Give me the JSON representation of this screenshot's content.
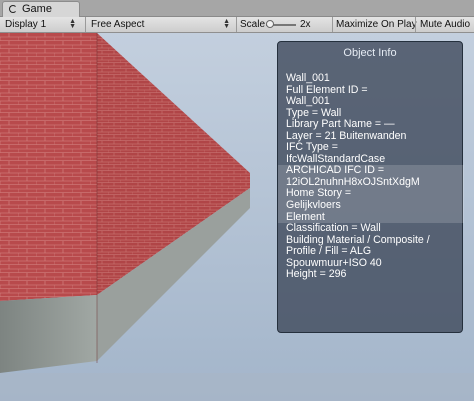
{
  "window": {
    "tab_label": "Game",
    "tab_icon": "unity-game-icon"
  },
  "toolbar": {
    "display": "Display 1",
    "aspect": "Free Aspect",
    "scale_label": "Scale",
    "scale_value": "2x",
    "scale_level": 0.1,
    "maximize": "Maximize On Play",
    "mute": "Mute Audio"
  },
  "info_panel": {
    "title": "Object Info",
    "lines": [
      "Wall_001",
      "Full Element ID          =",
      "Wall_001",
      "Type          = Wall",
      "Library Part Name        = —",
      "Layer         = 21 Buitenwanden",
      "IFC Type     =",
      "IfcWallStandardCase",
      "ARCHICAD IFC ID     =",
      "12iOL2nuhnH8xOJSntXdgM",
      "Home Story              =",
      "Gelijkvloers",
      "Element",
      "Classification              = Wall",
      "Building Material / Composite /",
      "Profile / Fill              = ALG",
      "Spouwmuur+ISO 40",
      "Height        = 296"
    ]
  },
  "scene": {
    "brick_color": "#b84a4c",
    "plinth_color": "#8d9491",
    "sky_color": "#aebed2"
  }
}
